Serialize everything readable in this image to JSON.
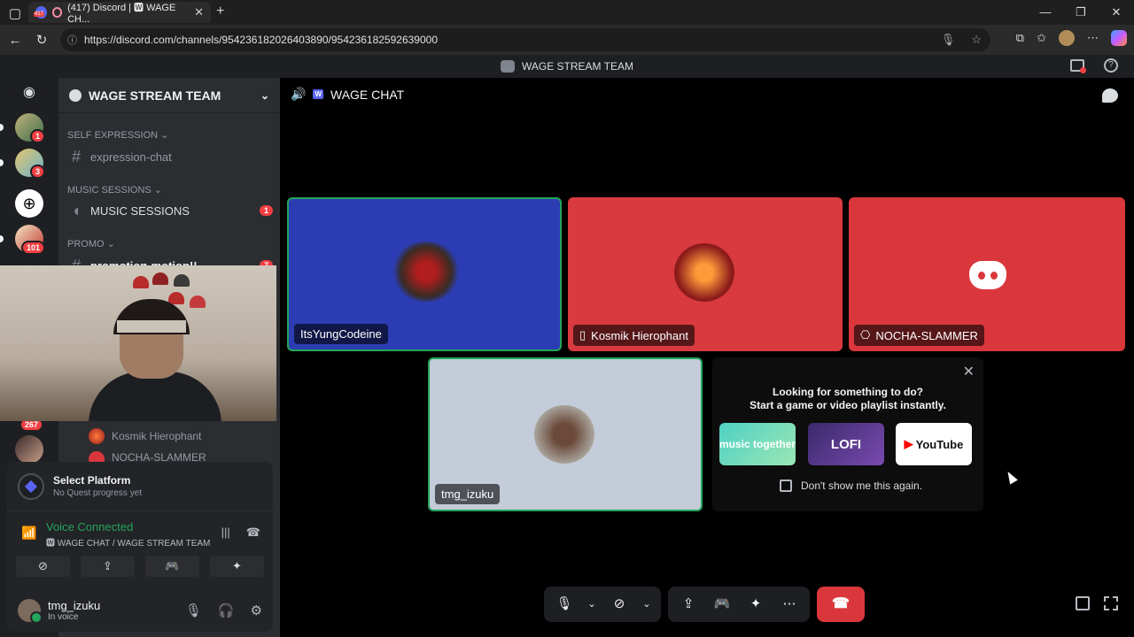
{
  "browser": {
    "tab_title": "(417) Discord | 🆆 WAGE CH...",
    "tab_badge": "417",
    "url": "https://discord.com/channels/954236182026403890/954236182592639000"
  },
  "app": {
    "window_title": "WAGE STREAM TEAM"
  },
  "guilds": [
    {
      "badge": "1"
    },
    {
      "badge": "3"
    },
    {
      "badge": ""
    },
    {
      "badge": "101"
    },
    {
      "badge": "267"
    }
  ],
  "sidebar": {
    "server_name": "WAGE STREAM TEAM",
    "categories": [
      {
        "name": "SELF EXPRESSION",
        "channel": "expression-chat",
        "badge": ""
      },
      {
        "name": "MUSIC SESSIONS",
        "channel": "MUSIC SESSIONS",
        "badge": "1"
      },
      {
        "name": "PROMO",
        "channel": "promotion-motion!!",
        "badge": "7"
      }
    ],
    "voice_users": [
      "Kosmik Hierophant",
      "NOCHA-SLAMMER"
    ]
  },
  "user_panel": {
    "quest_title": "Select Platform",
    "quest_sub": "No Quest progress yet",
    "voice_status": "Voice Connected",
    "voice_channel": "🆆 WAGE CHAT / WAGE STREAM TEAM",
    "username": "tmg_izuku",
    "user_status": "In voice"
  },
  "main": {
    "channel_name": "WAGE CHAT",
    "channel_tag": "W",
    "tiles": [
      {
        "name": "ItsYungCodeine",
        "color": "#2c3db3",
        "speaking": true
      },
      {
        "name": "Kosmik Hierophant",
        "color": "#d83a3f",
        "speaking": false
      },
      {
        "name": "NOCHA-SLAMMER",
        "color": "#da373c",
        "speaking": false
      },
      {
        "name": "tmg_izuku",
        "color": "#c4cbd9",
        "speaking": true
      }
    ],
    "activity": {
      "line1": "Looking for something to do?",
      "line2": "Start a game or video playlist instantly.",
      "app1": "music together",
      "app2": "LOFI",
      "app3": "YouTube",
      "dont_show": "Don't show me this again."
    }
  }
}
